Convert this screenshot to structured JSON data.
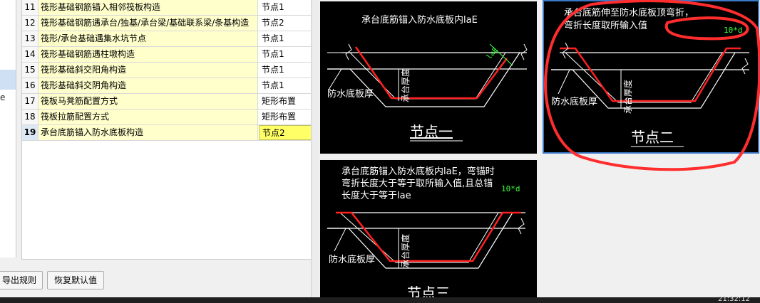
{
  "left_fragment": "e",
  "rows": [
    {
      "num": "11",
      "name": "筏形基础钢筋锚入相邻筏板构造",
      "value": "节点1"
    },
    {
      "num": "12",
      "name": "筏形基础钢筋遇承台/独基/承台梁/基础联系梁/条基构造",
      "value": "节点2"
    },
    {
      "num": "13",
      "name": "筏形/承台基础遇集水坑节点",
      "value": "节点1"
    },
    {
      "num": "14",
      "name": "筏形基础钢筋遇柱墩构造",
      "value": "节点1"
    },
    {
      "num": "15",
      "name": "筏形基础斜交阳角构造",
      "value": "节点1"
    },
    {
      "num": "16",
      "name": "筏形基础斜交阴角构造",
      "value": "节点1"
    },
    {
      "num": "17",
      "name": "筏板马凳筋配置方式",
      "value": "矩形布置"
    },
    {
      "num": "18",
      "name": "筏板拉筋配置方式",
      "value": "矩形布置"
    },
    {
      "num": "19",
      "name": "承台底筋锚入防水底板构造",
      "value": "节点2"
    }
  ],
  "buttons": {
    "export": "导出规则",
    "restore": "恢复默认值"
  },
  "node1": {
    "caption": "承台底筋锚入防水底板内laE",
    "lae": "laE",
    "thickness": "承台厚度",
    "waterproof": "防水底板厚",
    "title": "节点一"
  },
  "node2": {
    "caption1": "承台底筋伸至防水底板顶弯折，",
    "caption2": "弯折长度取所输入值",
    "dim": "10*d",
    "thickness": "承台厚度",
    "waterproof": "防水底板厚",
    "title": "节点二"
  },
  "node3": {
    "caption1": "承台底筋锚入防水底板内laE，弯锚时",
    "caption2": "弯折长度大于等于取所输入值,且总锚",
    "caption3": "长度大于等于lae",
    "dim": "10*d",
    "thickness": "承台厚度",
    "waterproof": "防水底板厚",
    "title": "节点三"
  },
  "taskbar": {
    "time": "21:32:12"
  },
  "colors": {
    "rebar": "#ff2020",
    "dim": "#3cff3c",
    "highlight": "#ff2d2d",
    "selected_value": "#ffff66",
    "name_bg": "#ffffcc"
  }
}
